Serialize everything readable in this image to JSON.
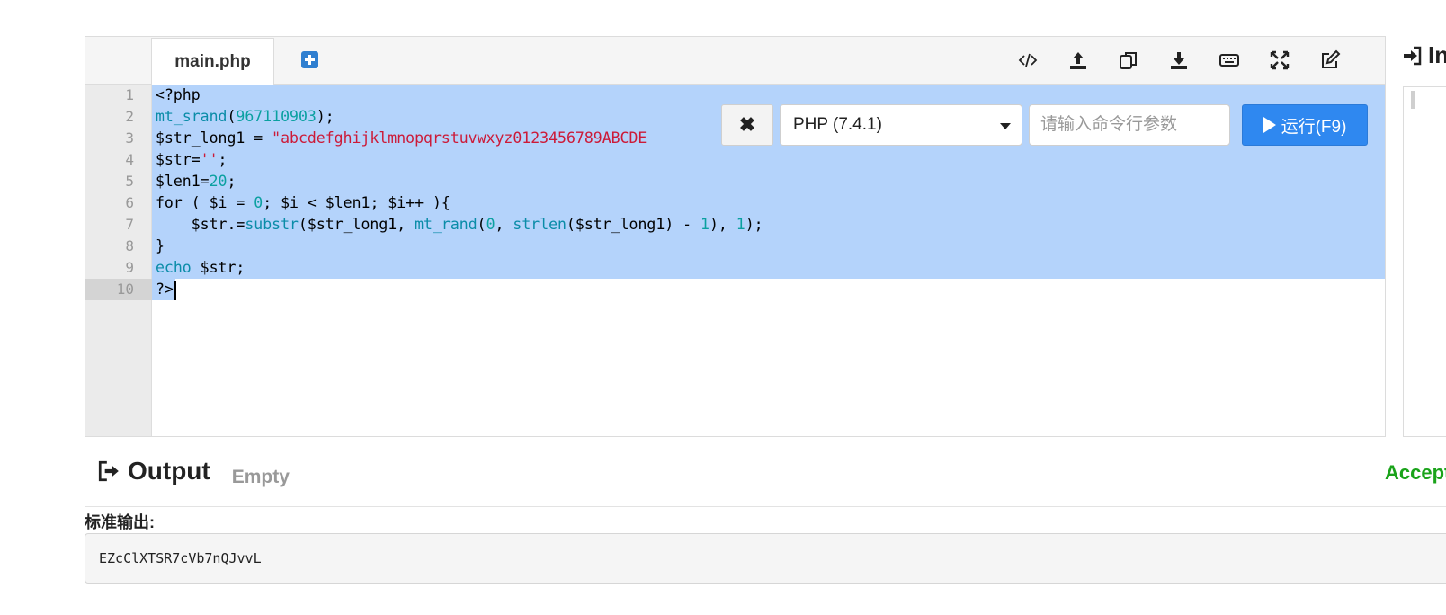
{
  "editor": {
    "tab_label": "main.php",
    "toolbar_icons": [
      "code-icon",
      "upload-icon",
      "copy-icon",
      "download-icon",
      "keyboard-icon",
      "fullscreen-icon",
      "edit-icon"
    ],
    "line_numbers": [
      "1",
      "2",
      "3",
      "4",
      "5",
      "6",
      "7",
      "8",
      "9",
      "10"
    ],
    "code": {
      "l1": "<?php",
      "l2_fn": "mt_srand",
      "l2_num": "967110903",
      "l3_var": "$str_long1 = ",
      "l3_str": "\"abcdefghijklmnopqrstuvwxyz0123456789ABCDE",
      "l4_var": "$str=",
      "l4_str": "''",
      "l5_var": "$len1=",
      "l5_num": "20",
      "l6_kw": "for",
      "l6_a": " ( $i = ",
      "l6_num": "0",
      "l6_b": "; $i < $len1; $i++ ){",
      "l7_a": "    $str.=",
      "l7_fn1": "substr",
      "l7_b": "($str_long1, ",
      "l7_fn2": "mt_rand",
      "l7_c": "(",
      "l7_num1": "0",
      "l7_d": ", ",
      "l7_fn3": "strlen",
      "l7_e": "($str_long1) - ",
      "l7_num2": "1",
      "l7_f": "), ",
      "l7_num3": "1",
      "l7_g": ");",
      "l8": "}",
      "l9_fn": "echo",
      "l9_rest": " $str;",
      "l10": "?>"
    }
  },
  "run_bar": {
    "close_label": "✖",
    "language": "PHP (7.4.1)",
    "args_placeholder": "请输入命令行参数",
    "run_label": "运行(F9)"
  },
  "input_panel": {
    "title": "In"
  },
  "output": {
    "title": "Output",
    "status": "Empty",
    "result": "Accept",
    "stdout_label": "标准输出:",
    "stdout_value": "EZcClXTSR7cVb7nQJvvL"
  }
}
